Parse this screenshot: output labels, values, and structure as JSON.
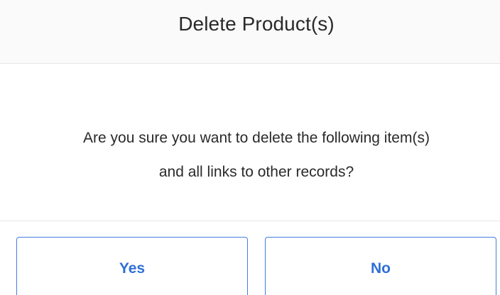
{
  "dialog": {
    "title": "Delete Product(s)",
    "message_line1": "Are you sure you want to delete the following item(s)",
    "message_line2": "and all links to other records?",
    "yes_label": "Yes",
    "no_label": "No"
  },
  "colors": {
    "accent": "#2f6fd6",
    "button_border": "#3f7fe0",
    "header_background": "#fafafa",
    "divider": "#e6e6e6",
    "text": "#2a2a2a"
  }
}
